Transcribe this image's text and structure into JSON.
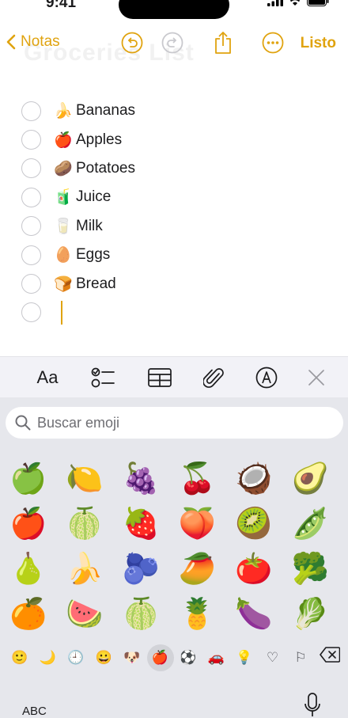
{
  "status": {
    "time": "9:41"
  },
  "nav": {
    "back_label": "Notas",
    "ghost_title": "Groceries List",
    "done_label": "Listo",
    "accent_color": "#e0a30f"
  },
  "checklist": [
    {
      "emoji": "🍌",
      "label": "Bananas",
      "checked": false
    },
    {
      "emoji": "🍎",
      "label": "Apples",
      "checked": false
    },
    {
      "emoji": "🥔",
      "label": "Potatoes",
      "checked": false
    },
    {
      "emoji": "🧃",
      "label": "Juice",
      "checked": false
    },
    {
      "emoji": "🥛",
      "label": "Milk",
      "checked": false
    },
    {
      "emoji": "🥚",
      "label": "Eggs",
      "checked": false
    },
    {
      "emoji": "🍞",
      "label": "Bread",
      "checked": false
    }
  ],
  "toolbar": {
    "format_label": "Aa"
  },
  "keyboard": {
    "search_placeholder": "Buscar emoji",
    "emoji_rows": [
      [
        "🍏",
        "🍋",
        "🍇",
        "🍒",
        "🥥",
        "🥑"
      ],
      [
        "🍎",
        "🍈",
        "🍓",
        "🍑",
        "🥝",
        "🫛"
      ],
      [
        "🍐",
        "🍌",
        "🫐",
        "🥭",
        "🍅",
        "🥦"
      ],
      [
        "🍊",
        "🍉",
        "🍈",
        "🍍",
        "🍆",
        "🥬"
      ]
    ],
    "categories": [
      "🙂",
      "🌙",
      "🕘",
      "😀",
      "🐶",
      "🍎",
      "⚽",
      "🚗",
      "💡",
      "♡",
      "⚐"
    ],
    "selected_category_index": 5,
    "abc_label": "ABC"
  }
}
